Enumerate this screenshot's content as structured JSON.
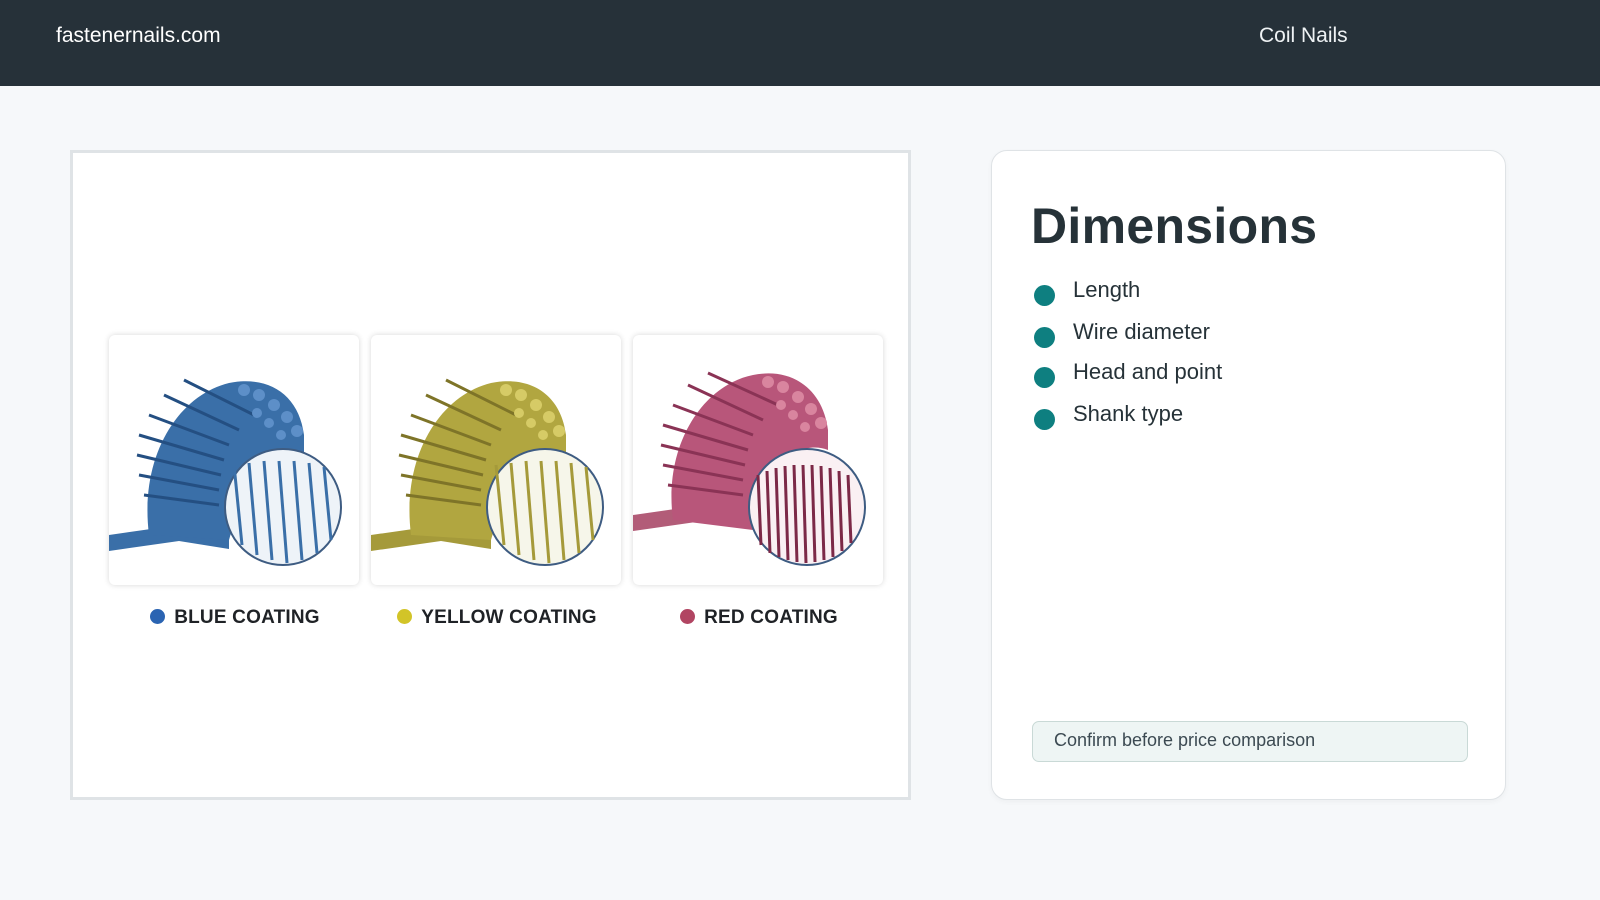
{
  "header": {
    "site_name": "fastenernails.com",
    "page_label": "Coil Nails",
    "background_color": "#263139"
  },
  "media": {
    "products": [
      {
        "label": "BLUE COATING",
        "color": "#2b64b2"
      },
      {
        "label": "YELLOW COATING",
        "color": "#d2c428"
      },
      {
        "label": "RED COATING",
        "color": "#b14562"
      }
    ]
  },
  "info": {
    "title": "Dimensions",
    "bullet_color": "#0e7f80",
    "specs": [
      "Length",
      "Wire diameter",
      "Head and point",
      "Shank type"
    ],
    "note": "Confirm before price comparison"
  }
}
